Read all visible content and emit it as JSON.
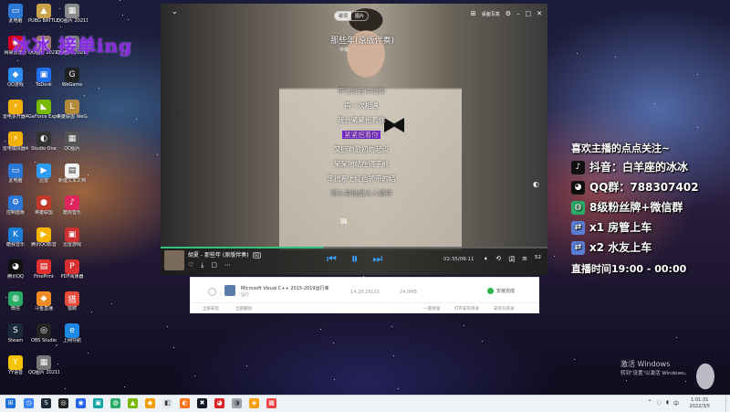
{
  "overlay_title": "冰冰 接单ing",
  "desktop_icons": [
    {
      "label": "此电脑",
      "color": "#2b78d6",
      "glyph": "▭"
    },
    {
      "label": "PUBG BATTLEGR...",
      "color": "#c9a24a",
      "glyph": "▲"
    },
    {
      "label": "QQ图片 2021121...",
      "color": "#8a8a8a",
      "glyph": "▦"
    },
    {
      "label": "网易云音乐",
      "color": "#d6001c",
      "glyph": "◉"
    },
    {
      "label": "QQ图片 2021121...",
      "color": "#9a7a6a",
      "glyph": "▦"
    },
    {
      "label": "QQ图片 2021121...",
      "color": "#7a7a7a",
      "glyph": "▦"
    },
    {
      "label": "QQ游戏",
      "color": "#2d8cf0",
      "glyph": "◆"
    },
    {
      "label": "ToDesk",
      "color": "#1f6feb",
      "glyph": "▣"
    },
    {
      "label": "WeGame",
      "color": "#222222",
      "glyph": "G"
    },
    {
      "label": "雷电多开器4",
      "color": "#f2b10a",
      "glyph": "⚡"
    },
    {
      "label": "GeForce Experience",
      "color": "#76b900",
      "glyph": "◣"
    },
    {
      "label": "英雄联盟 WeGame版",
      "color": "#b18a3a",
      "glyph": "L"
    },
    {
      "label": "雷电模拟器4",
      "color": "#f2b10a",
      "glyph": "⚡"
    },
    {
      "label": "Studio One",
      "color": "#333333",
      "glyph": "◐"
    },
    {
      "label": "QQ图片",
      "color": "#555555",
      "glyph": "▦"
    },
    {
      "label": "此电脑",
      "color": "#2b78d6",
      "glyph": "▭"
    },
    {
      "label": "迅雷",
      "color": "#2d9cf0",
      "glyph": "▶"
    },
    {
      "label": "新建文本文档",
      "color": "#f0f0f0",
      "glyph": "▤"
    },
    {
      "label": "控制面板",
      "color": "#2b78d6",
      "glyph": "⚙"
    },
    {
      "label": "英雄联盟",
      "color": "#c0392b",
      "glyph": "●"
    },
    {
      "label": "酷狗音乐",
      "color": "#e0245e",
      "glyph": "♪"
    },
    {
      "label": "酷我音乐",
      "color": "#1c7ed6",
      "glyph": "K"
    },
    {
      "label": "腾讯QQ影音",
      "color": "#f7b500",
      "glyph": "▶"
    },
    {
      "label": "迅雷游戏",
      "color": "#d03030",
      "glyph": "▣"
    },
    {
      "label": "腾讯QQ",
      "color": "#111111",
      "glyph": "◕"
    },
    {
      "label": "FinePrint",
      "color": "#e03030",
      "glyph": "▤"
    },
    {
      "label": "PDF阅读器",
      "color": "#d63031",
      "glyph": "P"
    },
    {
      "label": "微信",
      "color": "#2aae67",
      "glyph": "◍"
    },
    {
      "label": "斗鱼直播",
      "color": "#f08a24",
      "glyph": "◆"
    },
    {
      "label": "猎聘",
      "color": "#e74c3c",
      "glyph": "猎"
    },
    {
      "label": "Steam",
      "color": "#1b2838",
      "glyph": "S"
    },
    {
      "label": "OBS Studio",
      "color": "#222222",
      "glyph": "◎"
    },
    {
      "label": "上网导航",
      "color": "#1e88e5",
      "glyph": "e"
    },
    {
      "label": "YY语音",
      "color": "#f5c400",
      "glyph": "Y"
    },
    {
      "label": "QQ图片 2021120...",
      "color": "#777777",
      "glyph": "▦"
    }
  ],
  "player": {
    "tabs": [
      "歌词",
      "图片"
    ],
    "active_tab": 0,
    "top_right_label": "桌面写真",
    "song_title": "那些年(原版伴奏)",
    "song_sub": "伴奏",
    "lyrics": [
      {
        "text": "平行时空中的你",
        "state": "dim"
      },
      {
        "text": "再一次相遇",
        "state": "normal"
      },
      {
        "text": "我会紧紧抱着你",
        "state": "normal"
      },
      {
        "text": "紧紧抱着你",
        "state": "current"
      },
      {
        "text": "又回到最初的起点",
        "state": "normal"
      },
      {
        "text": "呆呆地站在镜子前",
        "state": "normal"
      },
      {
        "text": "笨拙系上红色领带的结",
        "state": "normal"
      },
      {
        "text": "将头发梳成大人模样",
        "state": "dim"
      }
    ],
    "now_playing": "胡夏 - 那些年 (原版伴奏)",
    "badge": "SQ",
    "time": "02:35/06:11",
    "progress": 0.42,
    "count": "52"
  },
  "installer": {
    "name": "Microsoft Visual C++ 2015-2019运行库",
    "sub": "运行",
    "date": "14.28.29132",
    "size": "24.0MB",
    "status": "安装完成",
    "footer": [
      "全部安装",
      "全部删除",
      "一键清理",
      "打开安装目录",
      "安装包目录"
    ]
  },
  "panel": {
    "lines": [
      {
        "text": "喜欢主播的点点关注~",
        "icon": "",
        "color": ""
      },
      {
        "text": "抖音：白羊座的冰冰",
        "icon": "♪",
        "color": "#111111"
      },
      {
        "text": "QQ群：788307402",
        "icon": "◕",
        "color": "#111111"
      },
      {
        "text": "8级粉丝牌+微信群",
        "icon": "◍",
        "color": "#2aae67"
      },
      {
        "text": "x1 房管上车",
        "icon": "⇄",
        "color": "#5a7fd6"
      },
      {
        "text": "x2 水友上车",
        "icon": "⇄",
        "color": "#5a7fd6"
      },
      {
        "text": "直播时间19:00 - 00:00",
        "icon": "",
        "color": ""
      }
    ]
  },
  "activation": {
    "line1": "激活 Windows",
    "line2": "转到\"设置\"以激活 Windows。"
  },
  "taskbar": {
    "clock_time": "1:01:31",
    "clock_date": "2022/3/5",
    "tray_lang": "中",
    "apps": [
      {
        "glyph": "◷",
        "color": "#3b82f6"
      },
      {
        "glyph": "S",
        "color": "#1b2838"
      },
      {
        "glyph": "◎",
        "color": "#222222"
      },
      {
        "glyph": "◉",
        "color": "#2563eb"
      },
      {
        "glyph": "▣",
        "color": "#0ea5a4"
      },
      {
        "glyph": "◍",
        "color": "#2aae67"
      },
      {
        "glyph": "▲",
        "color": "#76b900"
      },
      {
        "glyph": "◆",
        "color": "#f59e0b"
      },
      {
        "glyph": "◧",
        "color": "#e5e7eb"
      },
      {
        "glyph": "◐",
        "color": "#f97316"
      },
      {
        "glyph": "✖",
        "color": "#111827"
      },
      {
        "glyph": "◕",
        "color": "#dc2626"
      },
      {
        "glyph": "◑",
        "color": "#9ca3af"
      },
      {
        "glyph": "◈",
        "color": "#f59e0b"
      },
      {
        "glyph": "▦",
        "color": "#ef4444"
      }
    ]
  }
}
